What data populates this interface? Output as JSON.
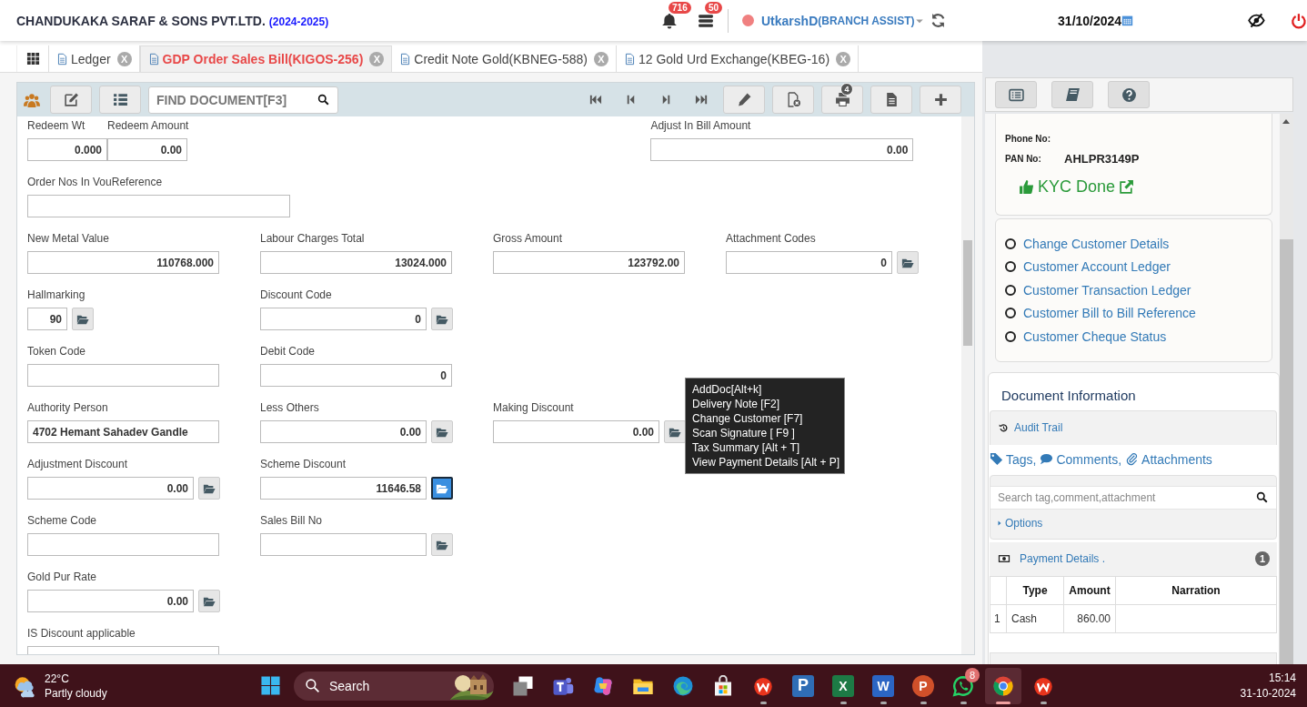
{
  "header": {
    "company": "CHANDUKAKA SARAF & SONS PVT.LTD.",
    "year": "(2024-2025)",
    "notifications": [
      {
        "kind": "bell",
        "badge": "716"
      },
      {
        "kind": "stack",
        "badge": "50"
      }
    ],
    "user": {
      "name": "UtkarshD",
      "role": "(BRANCH ASSIST)"
    },
    "date": "31/10/2024"
  },
  "tabs": [
    {
      "label": "Ledger",
      "close": "X",
      "selected": false
    },
    {
      "label": "GDP Order Sales Bill(KIGOS-256)",
      "close": "X",
      "selected": true
    },
    {
      "label": "Credit Note Gold(KBNEG-588)",
      "close": "X",
      "selected": false
    },
    {
      "label": "12 Gold Urd Exchange(KBEG-16)",
      "close": "X",
      "selected": false
    }
  ],
  "toolbar": {
    "search_placeholder": "FIND DOCUMENT[F3]",
    "print_badge": "4"
  },
  "form": {
    "rows": [
      {
        "kind": "split",
        "fields": [
          {
            "label": "Redeem Wt",
            "value": "0.000",
            "kind": "short"
          },
          {
            "label": "Redeem Amount",
            "value": "0.00",
            "kind": "short"
          },
          {
            "label": "Adjust In Bill Amount",
            "value": "0.00",
            "kind": "long"
          }
        ]
      },
      {
        "kind": "grid",
        "fields": [
          {
            "label": "Order Nos In VouReference",
            "kind": "long"
          }
        ]
      },
      {
        "kind": "grid",
        "fields": [
          {
            "label": "New Metal Value",
            "value": "110768.000",
            "kind": "number"
          },
          {
            "label": "Labour Charges Total",
            "value": "13024.000",
            "kind": "number"
          },
          {
            "label": "Gross Amount",
            "value": "123792.00",
            "kind": "number"
          },
          {
            "label": "Attachment Codes",
            "value": "0",
            "kind": "number",
            "lookup": {
              "focused": false
            }
          }
        ]
      },
      {
        "kind": "grid",
        "fields": [
          {
            "label": "Hallmarking",
            "value": "90",
            "kind": "tiny",
            "lookup": {
              "focused": false
            }
          },
          {
            "label": "Discount Code",
            "value": "0",
            "kind": "number",
            "lookup": {
              "focused": false
            }
          }
        ]
      },
      {
        "kind": "grid",
        "fields": [
          {
            "label": "Token Code",
            "kind": "text"
          },
          {
            "label": "Debit Code",
            "value": "0",
            "kind": "number"
          }
        ]
      },
      {
        "kind": "grid",
        "fields": [
          {
            "label": "Authority Person",
            "value": "4702 Hemant Sahadev Gandle",
            "kind": "text"
          },
          {
            "label": "Less Others",
            "value": "0.00",
            "kind": "number",
            "lookup": {
              "focused": false
            }
          },
          {
            "label": "Making Discount",
            "value": "0.00",
            "kind": "number",
            "lookup": {
              "focused": false
            }
          }
        ]
      },
      {
        "kind": "grid",
        "fields": [
          {
            "label": "Adjustment Discount",
            "value": "0.00",
            "kind": "number",
            "lookup": {
              "focused": false
            }
          },
          {
            "label": "Scheme Discount",
            "value": "11646.58",
            "kind": "number",
            "lookup": {
              "focused": true
            }
          }
        ]
      },
      {
        "kind": "grid",
        "fields": [
          {
            "label": "Scheme Code",
            "kind": "text"
          },
          {
            "label": "Sales Bill No",
            "kind": "number",
            "lookup": {
              "focused": false
            }
          }
        ]
      },
      {
        "kind": "grid",
        "fields": [
          {
            "label": "Gold Pur Rate",
            "value": "0.00",
            "kind": "number",
            "lookup": {
              "focused": false
            }
          }
        ]
      },
      {
        "kind": "grid",
        "fields": [
          {
            "label": "IS Discount applicable",
            "kind": "text"
          }
        ]
      }
    ]
  },
  "tooltip": [
    "AddDoc[Alt+k]",
    "Delivery Note [F2]",
    "Change Customer [F7]",
    "Scan Signature [ F9 ]",
    "Tax Summary [Alt + T]",
    "View Payment Details [Alt + P]"
  ],
  "customer": {
    "fields": [
      {
        "label": "Phone No:"
      },
      {
        "label": "PAN No:",
        "value": "AHLPR3149P"
      }
    ],
    "kyc": "KYC Done"
  },
  "customer_links": [
    {
      "label": "Change Customer Details",
      "selected": false
    },
    {
      "label": "Customer Account Ledger",
      "selected": false
    },
    {
      "label": "Customer Transaction Ledger",
      "selected": false
    },
    {
      "label": "Customer Bill to Bill Reference",
      "selected": false
    },
    {
      "label": "Customer Cheque Status",
      "selected": false
    }
  ],
  "document_info": {
    "title": "Document Information",
    "audit": "Audit Trail",
    "links": [
      {
        "kind": "tag",
        "label": "Tags,"
      },
      {
        "kind": "comment",
        "label": "Comments,"
      },
      {
        "kind": "clip",
        "label": "Attachments"
      }
    ],
    "search_placeholder": "Search tag,comment,attachment",
    "options": "Options",
    "payment": {
      "title": "Payment Details .",
      "count": "1",
      "columns": [
        "Type",
        "Amount",
        "Narration"
      ],
      "rows": [
        {
          "index": "1",
          "type": "Cash",
          "amount": "860.00"
        }
      ]
    }
  },
  "taskbar": {
    "weather": {
      "temp": "22°C",
      "desc": "Partly cloudy"
    },
    "search": "Search",
    "apps": [
      {
        "kind": "taskview",
        "running": false,
        "selected": false
      },
      {
        "kind": "teams",
        "running": false,
        "selected": false
      },
      {
        "kind": "copilot",
        "running": false,
        "selected": false
      },
      {
        "kind": "explorer",
        "running": false,
        "selected": false
      },
      {
        "kind": "edge",
        "running": false,
        "selected": false
      },
      {
        "kind": "store",
        "running": false,
        "selected": false
      },
      {
        "kind": "wps",
        "running": true,
        "selected": false
      },
      {
        "kind": "letter",
        "glyph": "P",
        "running": false,
        "selected": false
      },
      {
        "kind": "excel",
        "glyph": "X",
        "running": true,
        "selected": false
      },
      {
        "kind": "word",
        "glyph": "W",
        "running": true,
        "selected": false
      },
      {
        "kind": "ppt",
        "glyph": "P",
        "running": true,
        "selected": false
      },
      {
        "kind": "whatsapp",
        "badge": "8",
        "running": true,
        "selected": false
      },
      {
        "kind": "chrome",
        "running": true,
        "selected": true
      },
      {
        "kind": "wps",
        "running": true,
        "selected": false
      }
    ],
    "time": "15:14",
    "date": "31-10-2024"
  }
}
